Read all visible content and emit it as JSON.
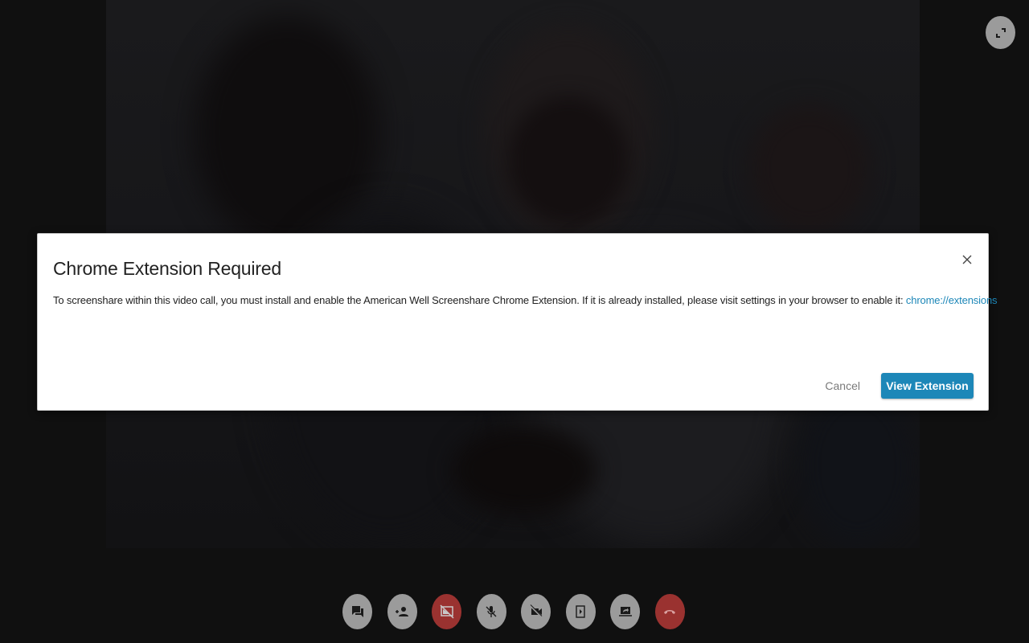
{
  "video": {
    "description": "remote participant video feed (dimmed)"
  },
  "fullscreen_button": {
    "icon": "fullscreen-icon"
  },
  "modal": {
    "title": "Chrome Extension Required",
    "body_text": "To screenshare within this video call, you must install and enable the American Well Screenshare Chrome Extension. If it is already installed, please visit settings in your browser to enable it: ",
    "link_text": "chrome://extensions",
    "close_icon": "close-icon",
    "cancel_label": "Cancel",
    "primary_label": "View Extension"
  },
  "controls": [
    {
      "name": "chat",
      "icon": "chat-icon",
      "state": "normal"
    },
    {
      "name": "invite-participant",
      "icon": "add-person-icon",
      "state": "normal"
    },
    {
      "name": "screenshare",
      "icon": "screenshare-off-icon",
      "state": "active-red"
    },
    {
      "name": "microphone",
      "icon": "mic-off-icon",
      "state": "normal"
    },
    {
      "name": "camera",
      "icon": "camera-off-icon",
      "state": "normal"
    },
    {
      "name": "media",
      "icon": "play-media-icon",
      "state": "normal"
    },
    {
      "name": "share-screen",
      "icon": "share-laptop-icon",
      "state": "normal"
    },
    {
      "name": "end-call",
      "icon": "hang-up-icon",
      "state": "end-red"
    }
  ],
  "colors": {
    "accent": "#1d87b8",
    "danger": "#9a3230",
    "control_gray": "#9b9b9b",
    "background": "#101010"
  }
}
